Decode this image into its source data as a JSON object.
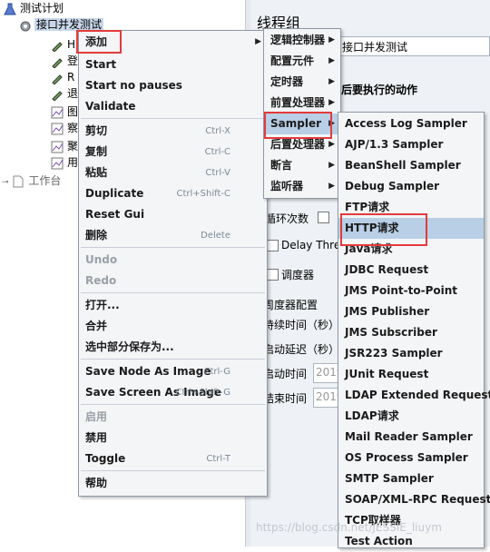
{
  "tree": {
    "root_label": "测试计划",
    "thread_group_label": "接口并发测试",
    "partial_items": [
      "H",
      "登",
      "R",
      "退",
      "图",
      "察",
      "聚",
      "用"
    ],
    "workbench_label": "工作台"
  },
  "panel": {
    "title": "线程组",
    "name_value": "接口并发测试",
    "on_error_label": "后要执行的动作",
    "loop_label": "循环次数",
    "delay_label": "Delay Thre",
    "scheduler_label": "调度器",
    "scheduler_config_label": "周度器配置",
    "duration_label": "持续时间（秒）",
    "startup_delay_label": "启动延迟（秒）",
    "start_time_label": "启动时间",
    "end_time_label": "结束时间",
    "start_time_value": "2019",
    "end_time_value": "2019"
  },
  "context_menu": {
    "items": [
      {
        "label": "添加",
        "arrow": "▶"
      },
      {
        "label": "Start"
      },
      {
        "label": "Start no pauses"
      },
      {
        "label": "Validate"
      },
      {
        "label": "剪切",
        "shortcut": "Ctrl-X"
      },
      {
        "label": "复制",
        "shortcut": "Ctrl-C"
      },
      {
        "label": "粘贴",
        "shortcut": "Ctrl-V"
      },
      {
        "label": "Duplicate",
        "shortcut": "Ctrl+Shift-C"
      },
      {
        "label": "Reset Gui"
      },
      {
        "label": "删除",
        "shortcut": "Delete"
      },
      {
        "label": "Undo"
      },
      {
        "label": "Redo"
      },
      {
        "label": "打开..."
      },
      {
        "label": "合并"
      },
      {
        "label": "选中部分保存为..."
      },
      {
        "label": "Save Node As Image",
        "shortcut": "Ctrl-G"
      },
      {
        "label": "Save Screen As Image",
        "shortcut": "Ctrl+Shift-G"
      },
      {
        "label": "启用"
      },
      {
        "label": "禁用"
      },
      {
        "label": "Toggle",
        "shortcut": "Ctrl-T"
      },
      {
        "label": "帮助"
      }
    ]
  },
  "add_submenu": {
    "items": [
      {
        "label": "逻辑控制器",
        "arrow": "▶"
      },
      {
        "label": "配置元件",
        "arrow": "▶"
      },
      {
        "label": "定时器",
        "arrow": "▶"
      },
      {
        "label": "前置处理器",
        "arrow": "▶"
      },
      {
        "label": "Sampler",
        "arrow": "▶"
      },
      {
        "label": "后置处理器",
        "arrow": "▶"
      },
      {
        "label": "断言",
        "arrow": "▶"
      },
      {
        "label": "监听器",
        "arrow": "▶"
      }
    ]
  },
  "sampler_submenu": {
    "items": [
      "Access Log Sampler",
      "AJP/1.3 Sampler",
      "BeanShell Sampler",
      "Debug Sampler",
      "FTP请求",
      "HTTP请求",
      "Java请求",
      "JDBC Request",
      "JMS Point-to-Point",
      "JMS Publisher",
      "JMS Subscriber",
      "JSR223 Sampler",
      "JUnit Request",
      "LDAP Extended Request",
      "LDAP请求",
      "Mail Reader Sampler",
      "OS Process Sampler",
      "SMTP Sampler",
      "SOAP/XML-RPC Request",
      "TCP取样器",
      "Test Action"
    ]
  },
  "watermark": "https://blog.csdn.net/JESSIE_liuym"
}
